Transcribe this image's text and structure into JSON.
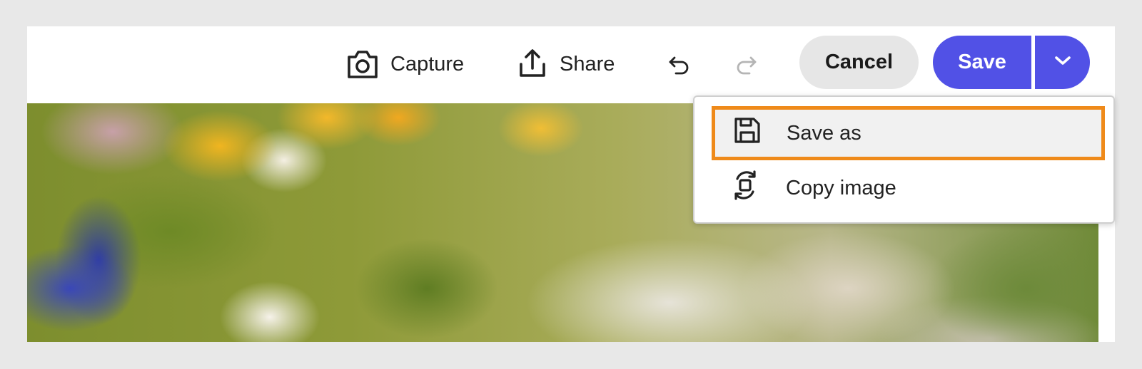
{
  "toolbar": {
    "capture_label": "Capture",
    "share_label": "Share",
    "cancel_label": "Cancel",
    "save_label": "Save"
  },
  "menu": {
    "items": [
      {
        "label": "Save as",
        "icon": "floppy-disk-icon",
        "selected": true
      },
      {
        "label": "Copy image",
        "icon": "copy-image-icon",
        "selected": false
      }
    ]
  },
  "colors": {
    "accent": "#5151e6",
    "highlight_border": "#ef8a1a",
    "cancel_bg": "#e6e6e6"
  }
}
